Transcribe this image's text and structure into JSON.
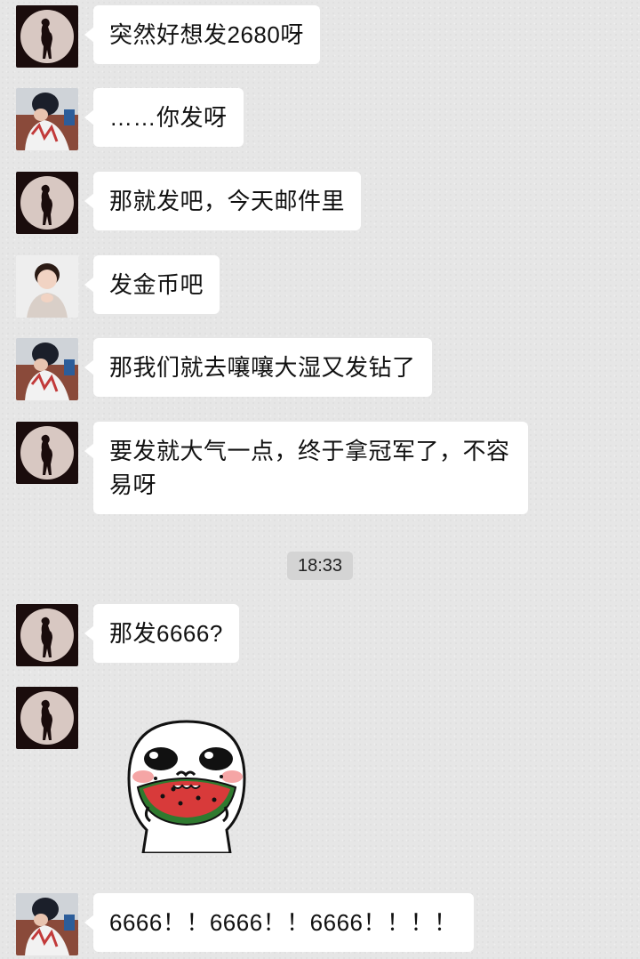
{
  "messages": [
    {
      "sender": "moon",
      "text": "突然好想发2680呀"
    },
    {
      "sender": "girl",
      "text": "……你发呀"
    },
    {
      "sender": "moon",
      "text": "那就发吧，今天邮件里"
    },
    {
      "sender": "baby",
      "text": "发金币吧"
    },
    {
      "sender": "girl",
      "text": "那我们就去嚷嚷大湿又发钻了"
    },
    {
      "sender": "moon",
      "text": "要发就大气一点，终于拿冠军了，不容易呀"
    },
    {
      "sender": "moon",
      "text": "那发6666?"
    },
    {
      "sender": "moon",
      "sticker": "eating-watermelon-sticker"
    },
    {
      "sender": "girl",
      "text": "6666！！6666！！6666！！！！"
    }
  ],
  "timestamp": "18:33"
}
